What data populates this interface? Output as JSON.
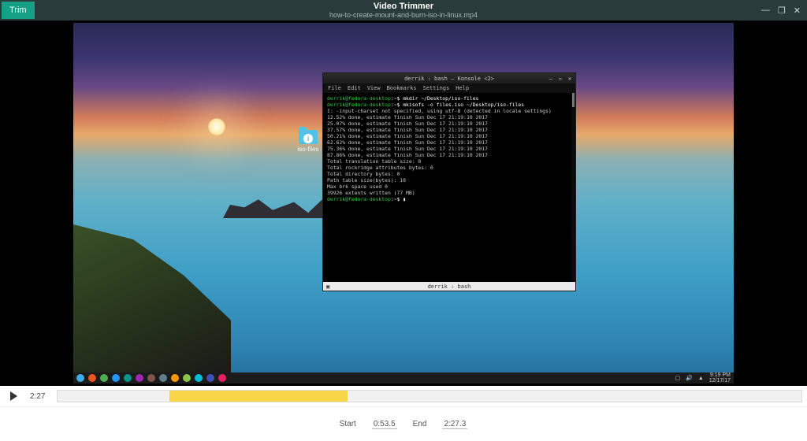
{
  "header": {
    "trim_label": "Trim",
    "app_title": "Video Trimmer",
    "file_title": "how-to-create-mount-and-burn-iso-in-linux.mp4"
  },
  "desktop": {
    "file_icon_label": "iso-files",
    "info_glyph": "i"
  },
  "konsole": {
    "title": "derrik : bash — Konsole <2>",
    "menu": [
      "File",
      "Edit",
      "View",
      "Bookmarks",
      "Settings",
      "Help"
    ],
    "status": "derrik : bash",
    "lines": [
      {
        "prompt": "derrik@fedora-desktop",
        "cmd": ":~$ mkdir ~/Desktop/iso-files"
      },
      {
        "prompt": "derrik@fedora-desktop",
        "cmd": ":~$ mkisofs -o files.iso ~/Desktop/iso-files"
      },
      {
        "out": "I: -input-charset not specified, using utf-8 (detected in locale settings)"
      },
      {
        "out": " 12.52% done, estimate finish Sun Dec 17 21:19:10 2017"
      },
      {
        "out": " 25.07% done, estimate finish Sun Dec 17 21:19:10 2017"
      },
      {
        "out": " 37.57% done, estimate finish Sun Dec 17 21:19:10 2017"
      },
      {
        "out": " 50.21% done, estimate finish Sun Dec 17 21:19:10 2017"
      },
      {
        "out": " 62.62% done, estimate finish Sun Dec 17 21:19:10 2017"
      },
      {
        "out": " 75.36% done, estimate finish Sun Dec 17 21:19:10 2017"
      },
      {
        "out": " 87.86% done, estimate finish Sun Dec 17 21:19:10 2017"
      },
      {
        "out": "Total translation table size: 0"
      },
      {
        "out": "Total rockridge attributes bytes: 0"
      },
      {
        "out": "Total directory bytes: 0"
      },
      {
        "out": "Path table size(bytes): 10"
      },
      {
        "out": "Max brk space used 0"
      },
      {
        "out": "39926 extents written (77 MB)"
      },
      {
        "prompt": "derrik@fedora-desktop",
        "cmd": ":~$ ▮"
      }
    ]
  },
  "taskbar": {
    "icon_colors": [
      "#3daee9",
      "#e95420",
      "#4caf50",
      "#2196f3",
      "#009688",
      "#9c27b0",
      "#795548",
      "#607d8b",
      "#ff9800",
      "#8bc34a",
      "#00bcd4",
      "#3f51b5",
      "#e91e63"
    ],
    "time": "9:19 PM",
    "date": "12/17/17"
  },
  "controls": {
    "current_time": "2:27",
    "start_label": "Start",
    "start_value": "0:53.5",
    "end_label": "End",
    "end_value": "2:27.3",
    "selection_left_pct": 15,
    "selection_width_pct": 24
  }
}
